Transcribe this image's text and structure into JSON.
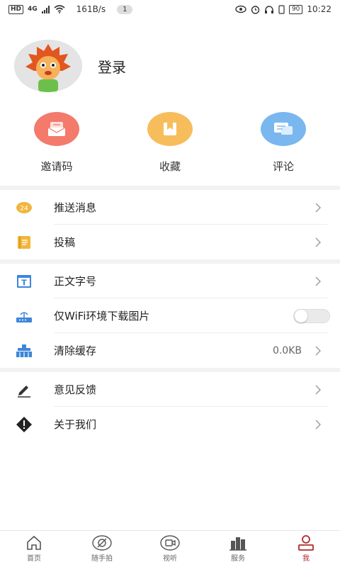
{
  "status_bar": {
    "hd": "HD",
    "signal": "4G",
    "speed": "161B/s",
    "notification_count": "1",
    "battery": "90",
    "time": "10:22"
  },
  "profile": {
    "login_label": "登录"
  },
  "quick_actions": [
    {
      "label": "邀请码",
      "color": "#f47a6c",
      "icon": "invite-icon"
    },
    {
      "label": "收藏",
      "color": "#f7bd5c",
      "icon": "bookmark-icon"
    },
    {
      "label": "评论",
      "color": "#7bb7ef",
      "icon": "comment-icon"
    }
  ],
  "settings": {
    "push": {
      "label": "推送消息",
      "badge": "24"
    },
    "contribute": {
      "label": "投稿"
    },
    "font_size": {
      "label": "正文字号"
    },
    "wifi_images": {
      "label": "仅WiFi环境下载图片",
      "enabled": false
    },
    "clear_cache": {
      "label": "清除缓存",
      "value": "0.0KB"
    },
    "feedback": {
      "label": "意见反馈"
    },
    "about": {
      "label": "关于我们"
    }
  },
  "bottom_nav": [
    {
      "label": "首页",
      "icon": "home-icon",
      "active": false
    },
    {
      "label": "随手拍",
      "icon": "camera-snap-icon",
      "active": false
    },
    {
      "label": "视听",
      "icon": "video-icon",
      "active": false
    },
    {
      "label": "服务",
      "icon": "buildings-icon",
      "active": false
    },
    {
      "label": "我",
      "icon": "profile-icon",
      "active": true
    }
  ],
  "colors": {
    "accent": "#b02a2a",
    "divider": "#f2f2f2"
  }
}
